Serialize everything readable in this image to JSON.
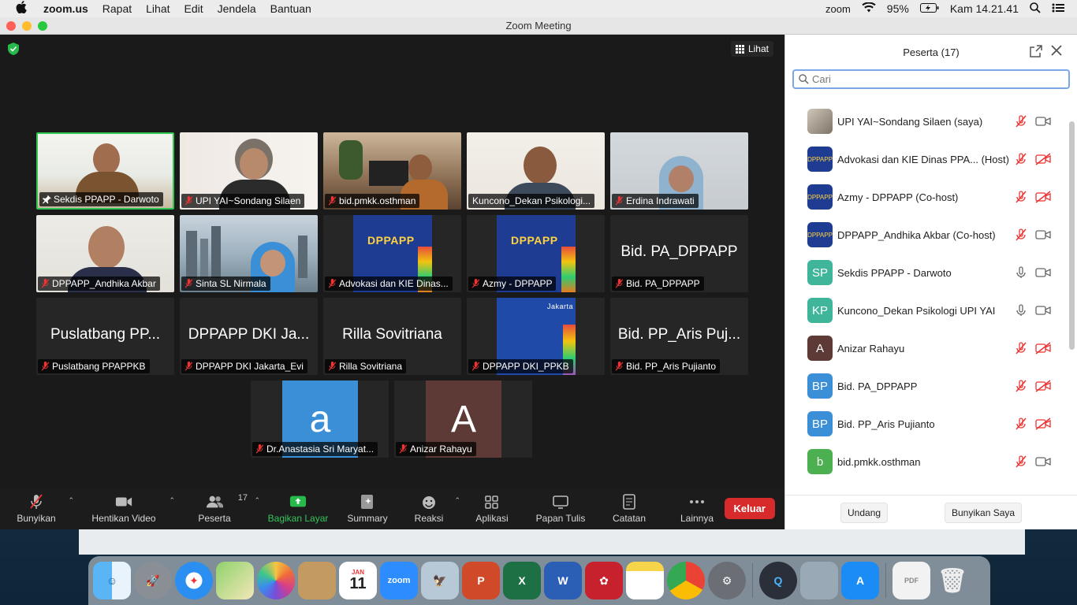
{
  "menubar": {
    "app_name": "zoom.us",
    "menus": [
      "Rapat",
      "Lihat",
      "Edit",
      "Jendela",
      "Bantuan"
    ],
    "status_app": "zoom",
    "battery": "95%",
    "clock": "Kam 14.21.41"
  },
  "window": {
    "title": "Zoom Meeting",
    "view_label": "Lihat"
  },
  "tiles": [
    {
      "name": "Sekdis PPAPP - Darwoto",
      "kind": "video"
    },
    {
      "name": "UPI YAI~Sondang Silaen",
      "kind": "video"
    },
    {
      "name": "bid.pmkk.osthman",
      "kind": "video"
    },
    {
      "name": "Kuncono_Dekan Psikologi...",
      "kind": "video"
    },
    {
      "name": "Erdina Indrawati",
      "kind": "video"
    },
    {
      "name": "DPPAPP_Andhika Akbar",
      "kind": "video"
    },
    {
      "name": "Sinta SL Nirmala",
      "kind": "video"
    },
    {
      "name": "Advokasi dan KIE Dinas...",
      "kind": "brand",
      "brand": "DPPAPP"
    },
    {
      "name": "Azmy - DPPAPP",
      "kind": "brand",
      "brand": "DPPAPP"
    },
    {
      "name": "Bid. PA_DPPAPP",
      "kind": "text",
      "big": "Bid. PA_DPPAPP"
    },
    {
      "name": "Puslatbang PPAPPKB",
      "kind": "text",
      "big": "Puslatbang PP..."
    },
    {
      "name": "DPPAPP DKI Jakarta_Evi",
      "kind": "text",
      "big": "DPPAPP DKI Ja..."
    },
    {
      "name": "Rilla Sovitriana",
      "kind": "text",
      "big": "Rilla Sovitriana"
    },
    {
      "name": "DPPAPP DKI_PPKB",
      "kind": "brand",
      "brand": "Jakarta"
    },
    {
      "name": "Bid. PP_Aris Pujianto",
      "kind": "text",
      "big": "Bid. PP_Aris Puj..."
    },
    {
      "name": "Dr.Anastasia Sri Maryat...",
      "kind": "letter",
      "letter": "a"
    },
    {
      "name": "Anizar Rahayu",
      "kind": "letter",
      "letter": "A"
    }
  ],
  "toolbar": {
    "mute": "Bunyikan",
    "stop_video": "Hentikan Video",
    "participants": "Peserta",
    "participants_count": "17",
    "share": "Bagikan Layar",
    "summary": "Summary",
    "reactions": "Reaksi",
    "apps": "Aplikasi",
    "whiteboard": "Papan Tulis",
    "notes": "Catatan",
    "more": "Lainnya",
    "leave": "Keluar"
  },
  "panel": {
    "title": "Peserta (17)",
    "search_placeholder": "Cari",
    "participants": [
      {
        "name": "UPI YAI~Sondang Silaen (saya)",
        "initials": "",
        "color": "#8a8a7a",
        "mic": "muted",
        "cam": "on"
      },
      {
        "name": "Advokasi dan KIE Dinas PPA...  (Host)",
        "initials": "",
        "color": "#1f3c93",
        "mic": "muted",
        "cam": "off"
      },
      {
        "name": "Azmy - DPPAPP (Co-host)",
        "initials": "",
        "color": "#1f3c93",
        "mic": "muted",
        "cam": "off"
      },
      {
        "name": "DPPAPP_Andhika Akbar (Co-host)",
        "initials": "",
        "color": "#1f3c93",
        "mic": "muted",
        "cam": "on"
      },
      {
        "name": "Sekdis PPAPP - Darwoto",
        "initials": "SP",
        "color": "#3fb59a",
        "mic": "on",
        "cam": "on"
      },
      {
        "name": "Kuncono_Dekan Psikologi UPI YAI",
        "initials": "KP",
        "color": "#3fb59a",
        "mic": "on",
        "cam": "on"
      },
      {
        "name": "Anizar Rahayu",
        "initials": "A",
        "color": "#5d3a35",
        "mic": "muted",
        "cam": "off"
      },
      {
        "name": "Bid. PA_DPPAPP",
        "initials": "BP",
        "color": "#3b8fd6",
        "mic": "muted",
        "cam": "off"
      },
      {
        "name": "Bid. PP_Aris Pujianto",
        "initials": "BP",
        "color": "#3b8fd6",
        "mic": "muted",
        "cam": "off"
      },
      {
        "name": "bid.pmkk.osthman",
        "initials": "b",
        "color": "#4caf50",
        "mic": "muted",
        "cam": "on"
      }
    ],
    "invite": "Undang",
    "unmute_me": "Bunyikan Saya"
  },
  "dock": {
    "calendar_month": "JAN",
    "calendar_day": "11",
    "zoom_label": "zoom"
  }
}
